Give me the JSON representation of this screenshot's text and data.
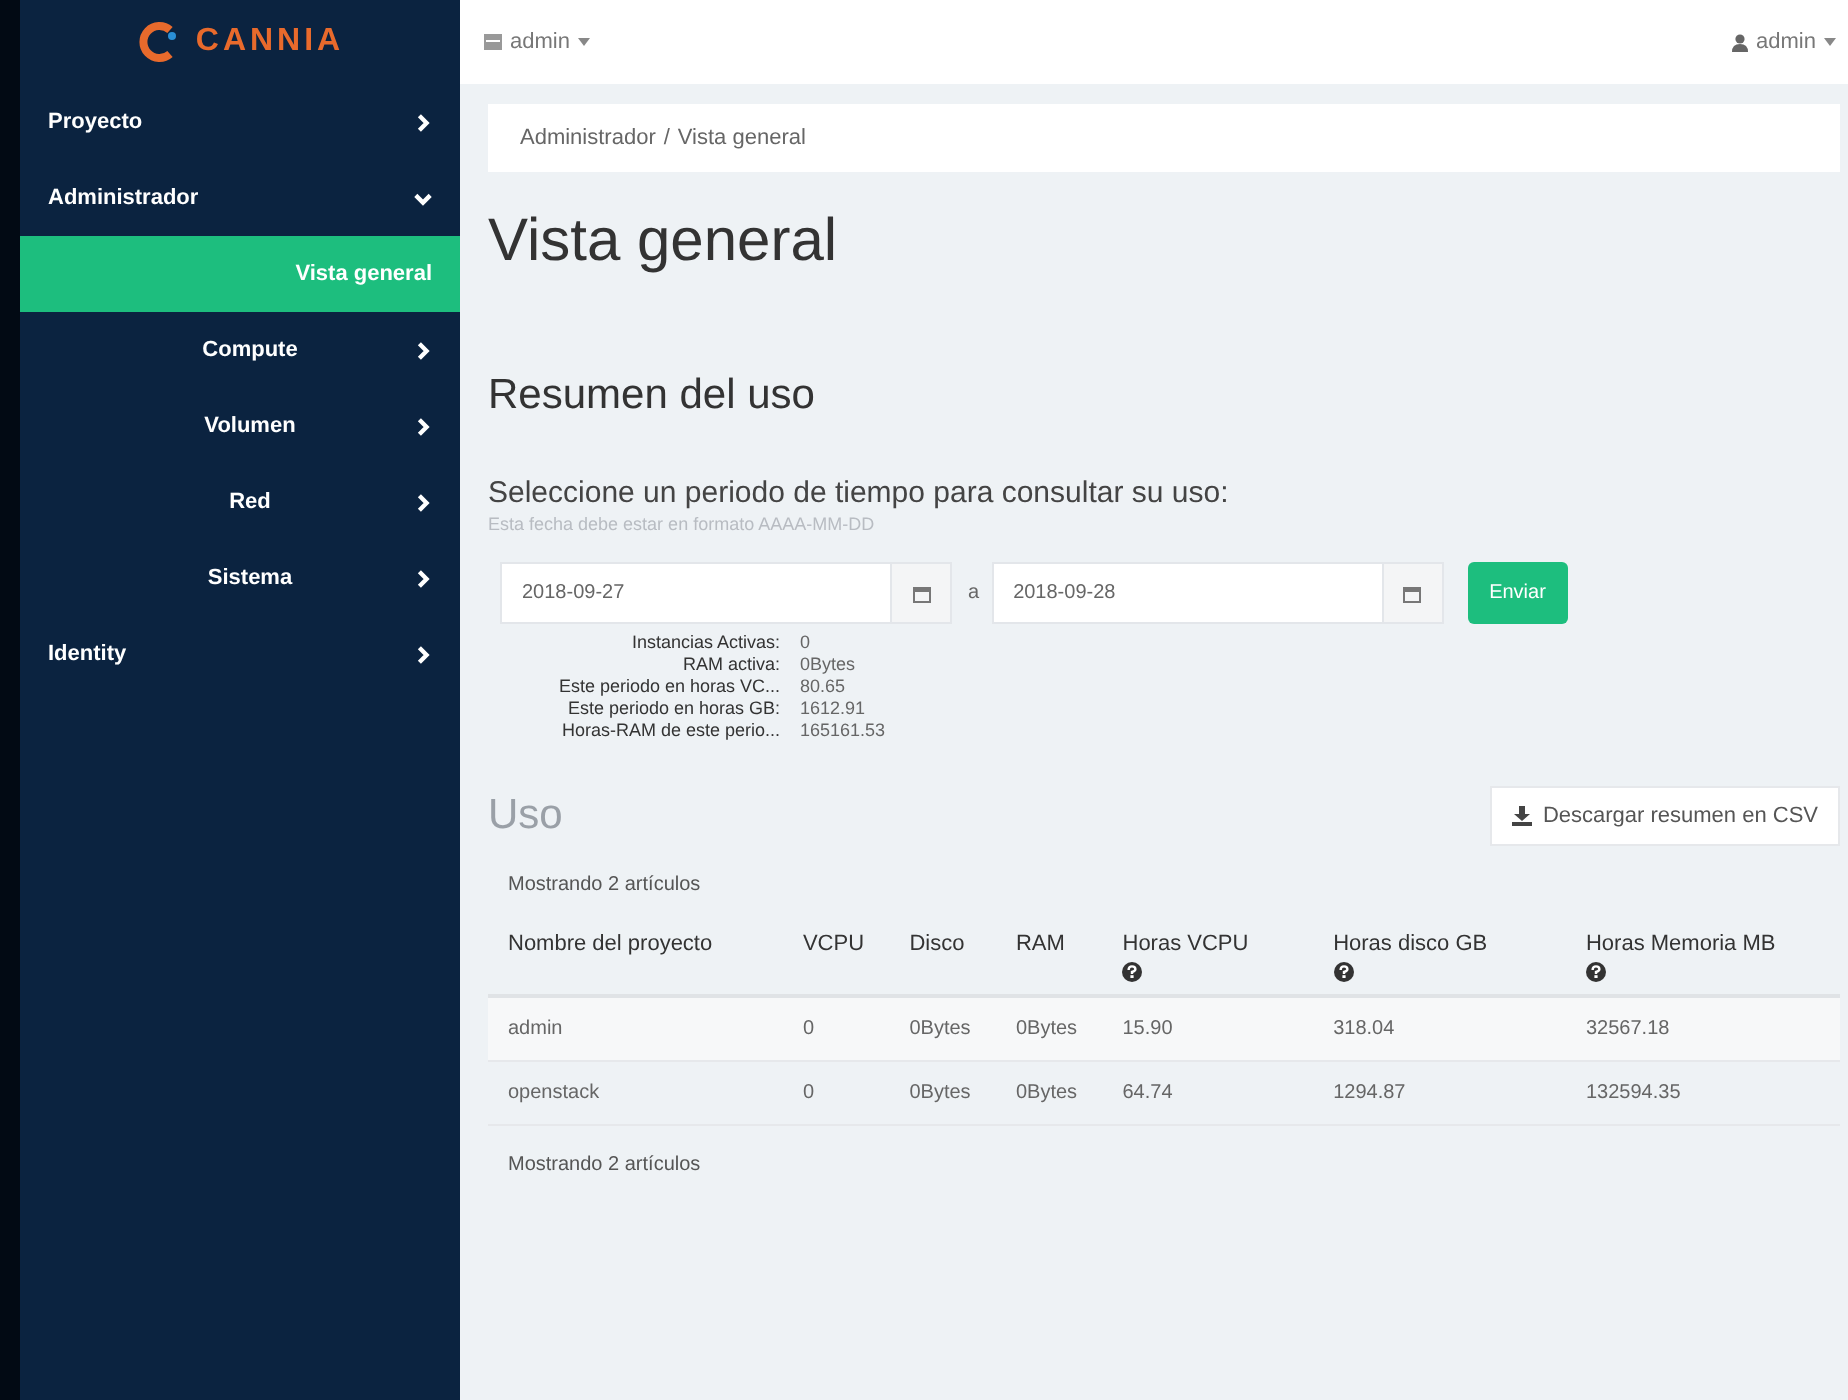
{
  "logo": {
    "text": "CANNIA"
  },
  "sidebar": {
    "items": [
      {
        "label": "Proyecto",
        "expanded": false
      },
      {
        "label": "Administrador",
        "expanded": true,
        "children": [
          {
            "label": "Vista general",
            "selected": true,
            "kind": "leaf"
          },
          {
            "label": "Compute",
            "selected": false,
            "kind": "group"
          },
          {
            "label": "Volumen",
            "selected": false,
            "kind": "group"
          },
          {
            "label": "Red",
            "selected": false,
            "kind": "group"
          },
          {
            "label": "Sistema",
            "selected": false,
            "kind": "group"
          }
        ]
      },
      {
        "label": "Identity",
        "expanded": false
      }
    ]
  },
  "topbar": {
    "project_menu": "admin",
    "user_menu": "admin"
  },
  "breadcrumb": {
    "items": [
      "Administrador",
      "Vista general"
    ],
    "separator": "/"
  },
  "page_title": "Vista general",
  "usage_summary": {
    "title": "Resumen del uso",
    "prompt": "Seleccione un periodo de tiempo para consultar su uso:",
    "hint": "Esta fecha debe estar en formato AAAA-MM-DD",
    "start_date": "2018-09-27",
    "separator": "a",
    "end_date": "2018-09-28",
    "submit": "Enviar",
    "stats": [
      {
        "label": "Instancias Activas:",
        "value": "0"
      },
      {
        "label": "RAM activa:",
        "value": "0Bytes"
      },
      {
        "label": "Este periodo en horas VC...",
        "value": "80.65"
      },
      {
        "label": "Este periodo en horas GB:",
        "value": "1612.91"
      },
      {
        "label": "Horas-RAM de este perio...",
        "value": "165161.53"
      }
    ]
  },
  "usage": {
    "title": "Uso",
    "download": "Descargar resumen en CSV",
    "count_top": "Mostrando 2 artículos",
    "count_bottom": "Mostrando 2 artículos",
    "columns": [
      {
        "label": "Nombre del proyecto",
        "help": false
      },
      {
        "label": "VCPU",
        "help": false
      },
      {
        "label": "Disco",
        "help": false
      },
      {
        "label": "RAM",
        "help": false
      },
      {
        "label": "Horas VCPU",
        "help": true
      },
      {
        "label": "Horas disco GB",
        "help": true
      },
      {
        "label": "Horas Memoria MB",
        "help": true
      }
    ],
    "rows": [
      [
        "admin",
        "0",
        "0Bytes",
        "0Bytes",
        "15.90",
        "318.04",
        "32567.18"
      ],
      [
        "openstack",
        "0",
        "0Bytes",
        "0Bytes",
        "64.74",
        "1294.87",
        "132594.35"
      ]
    ]
  }
}
